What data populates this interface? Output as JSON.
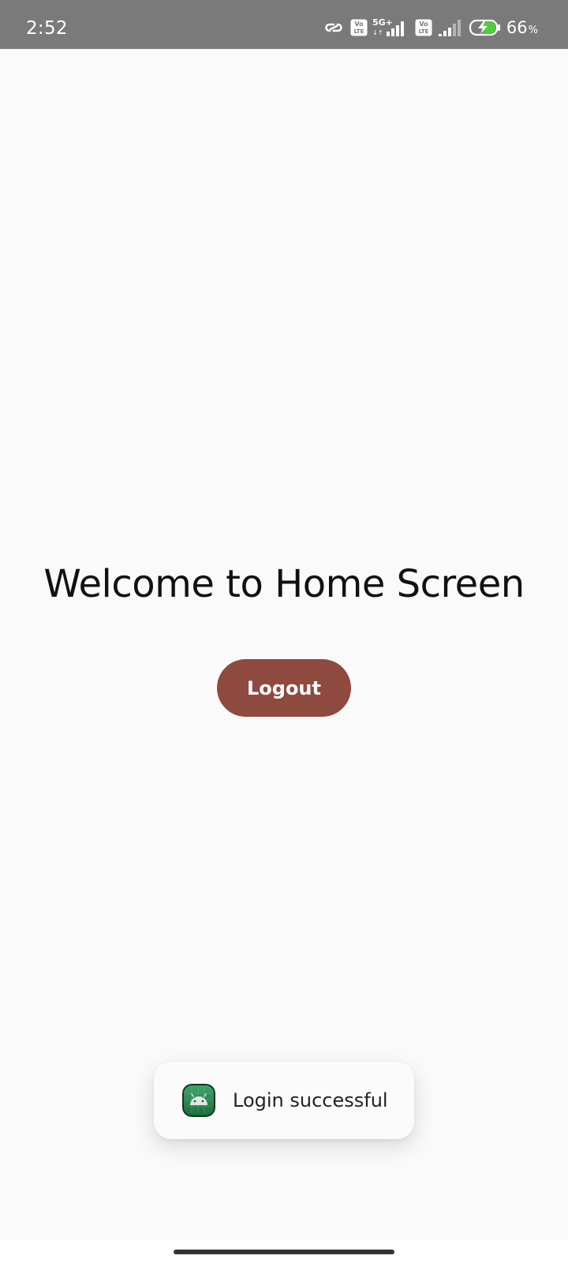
{
  "status_bar": {
    "time": "2:52",
    "battery_level": "66",
    "battery_unit": "%",
    "network_type": "5G+",
    "volte_label_top": "Vo",
    "volte_label_bottom": "LTE",
    "icons": [
      "link-icon",
      "volte-icon",
      "signal-5g-icon",
      "volte-icon",
      "signal-icon",
      "battery-charging-icon"
    ],
    "battery_color": "#4cd137"
  },
  "main": {
    "title": "Welcome to Home Screen",
    "logout_label": "Logout",
    "logout_color": "#8e4a3f"
  },
  "toast": {
    "message": "Login successful",
    "icon": "android-app-icon"
  }
}
